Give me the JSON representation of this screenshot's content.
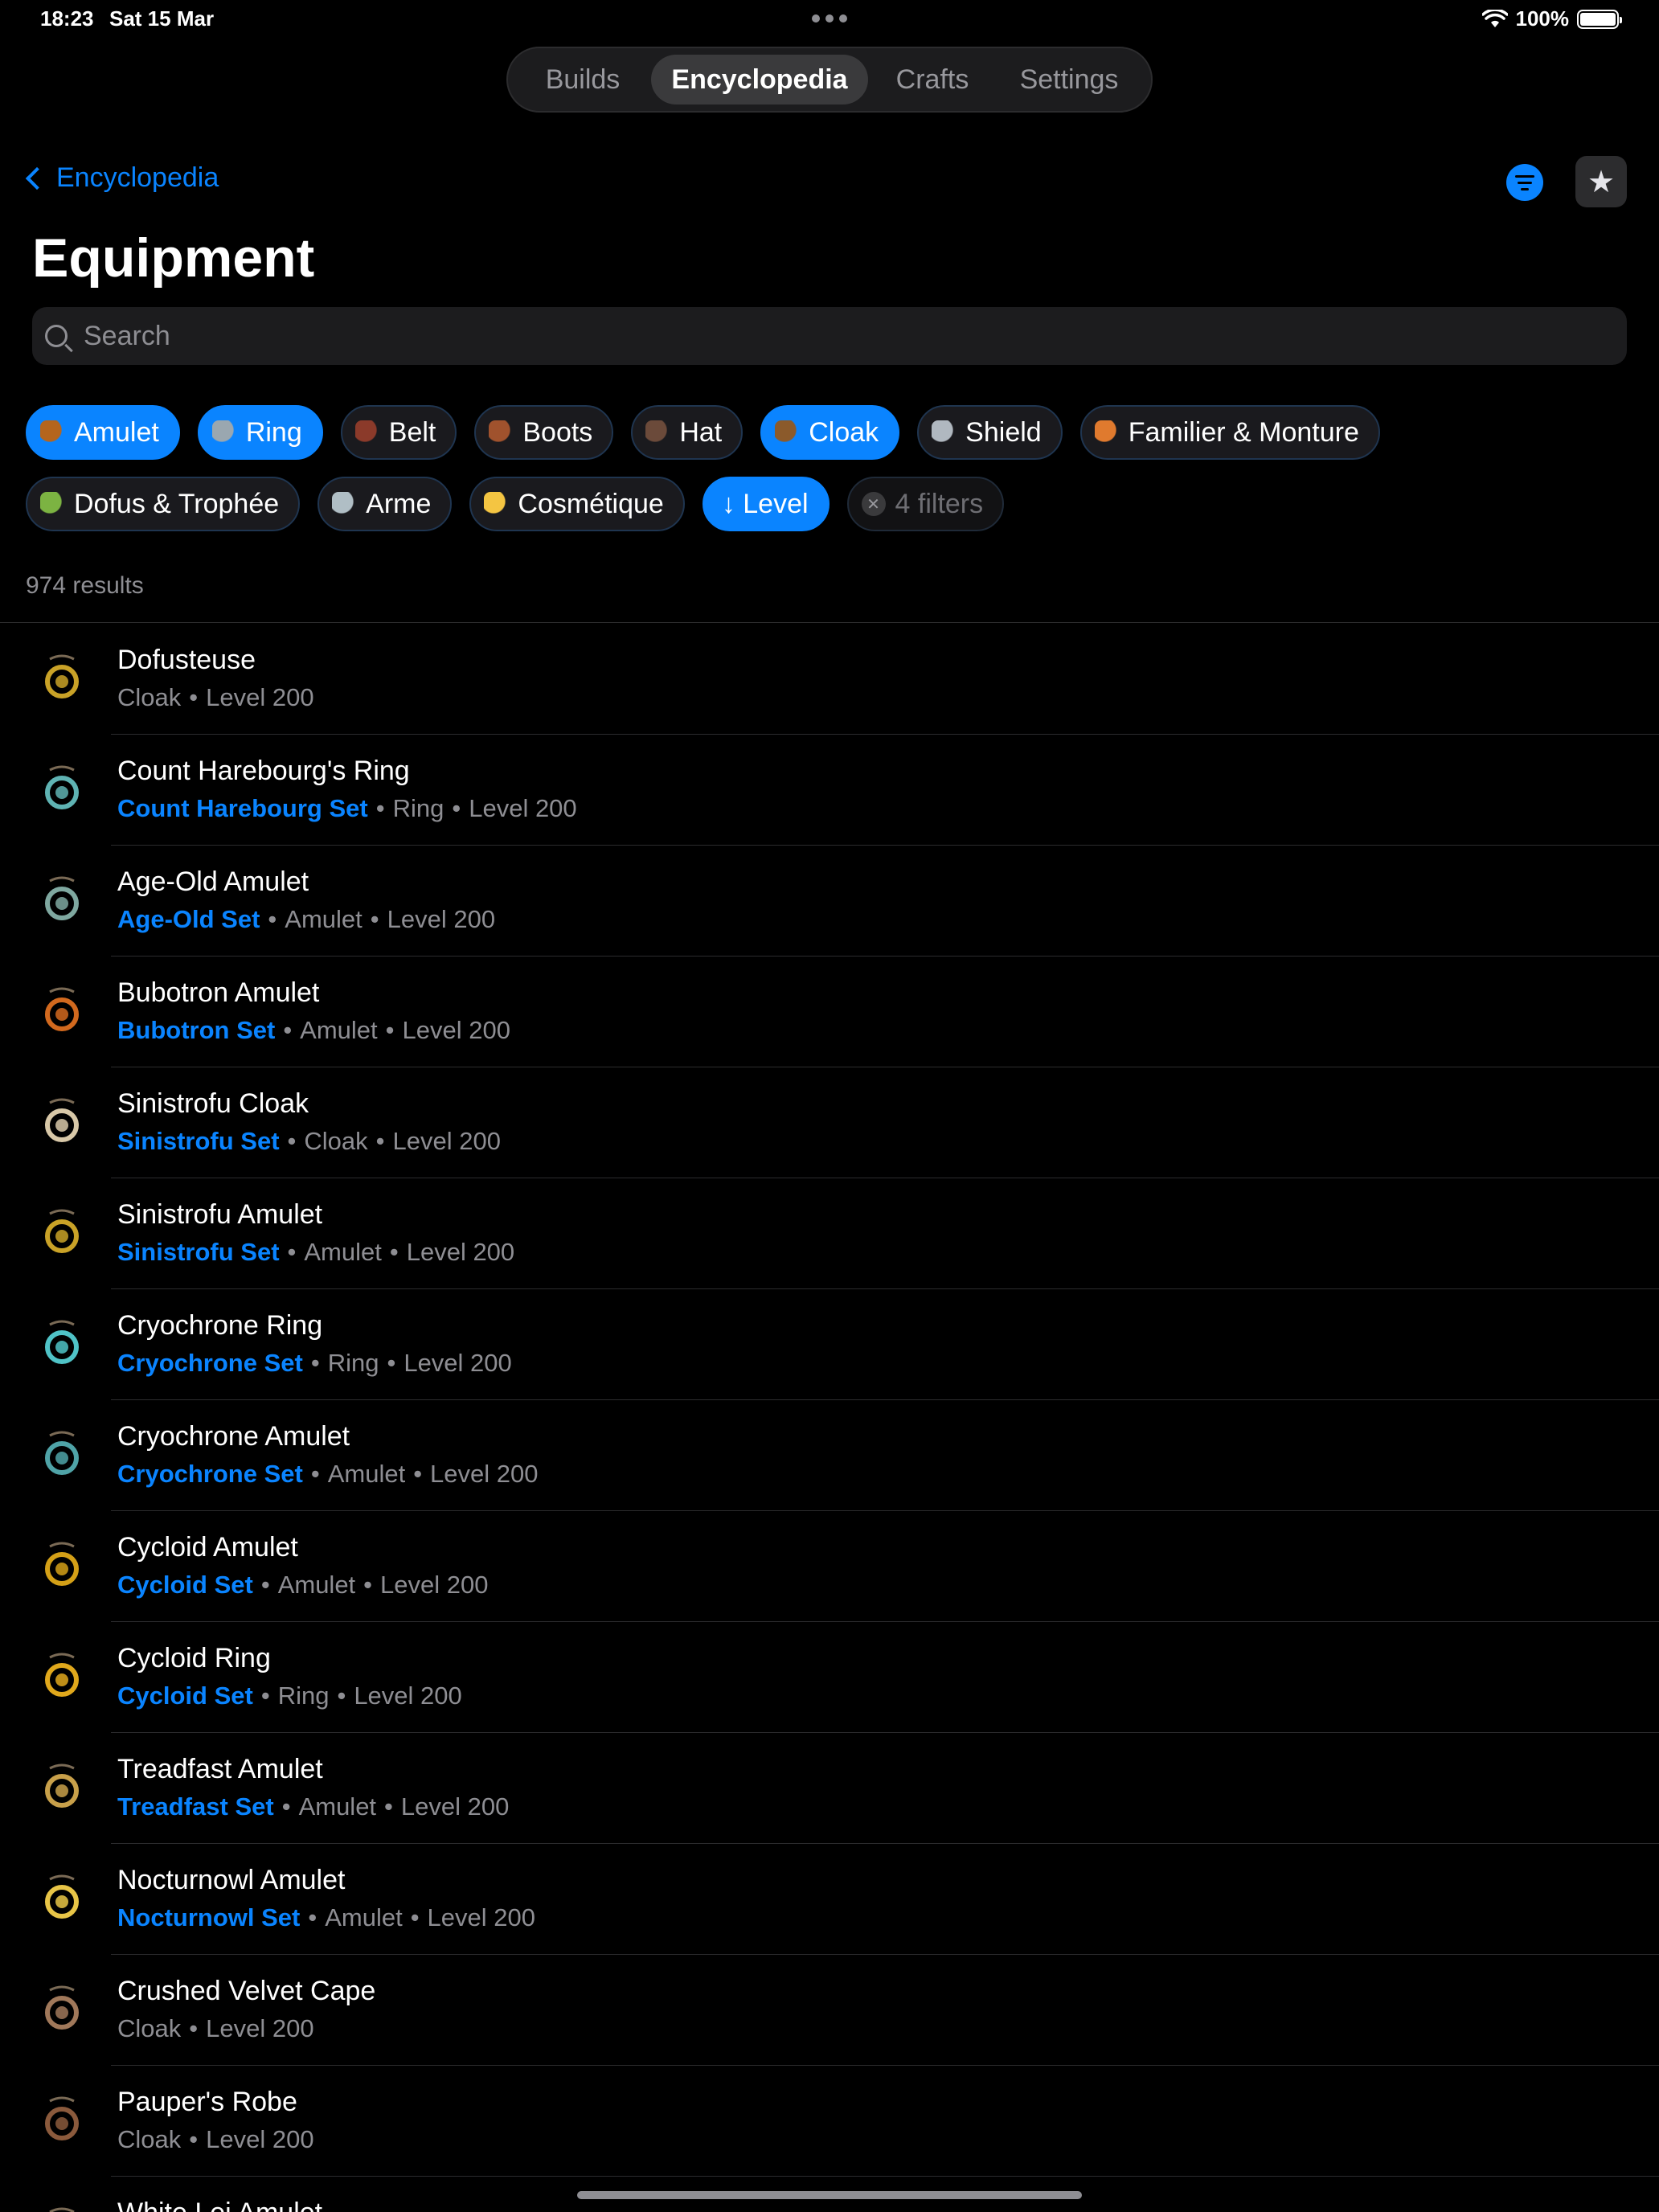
{
  "status": {
    "time": "18:23",
    "date": "Sat 15 Mar",
    "battery": "100%"
  },
  "tabs": [
    {
      "label": "Builds",
      "active": false
    },
    {
      "label": "Encyclopedia",
      "active": true
    },
    {
      "label": "Crafts",
      "active": false
    },
    {
      "label": "Settings",
      "active": false
    }
  ],
  "nav": {
    "back_label": "Encyclopedia"
  },
  "page": {
    "title": "Equipment"
  },
  "search": {
    "placeholder": "Search",
    "value": ""
  },
  "chips_row1": [
    {
      "label": "Amulet",
      "active": true,
      "icon": "amulet-icon",
      "color": "#b5651d"
    },
    {
      "label": "Ring",
      "active": true,
      "icon": "ring-icon",
      "color": "#9aa7b0"
    },
    {
      "label": "Belt",
      "active": false,
      "icon": "belt-icon",
      "color": "#8b3a2a"
    },
    {
      "label": "Boots",
      "active": false,
      "icon": "boots-icon",
      "color": "#a0522d"
    },
    {
      "label": "Hat",
      "active": false,
      "icon": "hat-icon",
      "color": "#6b4a3a"
    },
    {
      "label": "Cloak",
      "active": true,
      "icon": "cloak-icon",
      "color": "#8b5a2b"
    },
    {
      "label": "Shield",
      "active": false,
      "icon": "shield-icon",
      "color": "#b0b8c0"
    },
    {
      "label": "Familier & Monture",
      "active": false,
      "icon": "pet-icon",
      "color": "#e07a2e"
    }
  ],
  "chips_row2": [
    {
      "label": "Dofus & Trophée",
      "active": false,
      "icon": "dofus-egg-icon",
      "color": "#7cb342"
    },
    {
      "label": "Arme",
      "active": false,
      "icon": "weapon-icon",
      "color": "#b0bec5"
    },
    {
      "label": "Cosmétique",
      "active": false,
      "icon": "cosmetic-icon",
      "color": "#f4c542"
    }
  ],
  "sort_chip": {
    "label": "↓ Level"
  },
  "clear_chip": {
    "label": "4 filters"
  },
  "results": {
    "count_text": "974 results"
  },
  "items": [
    {
      "name": "Dofusteuse",
      "set": "",
      "type": "Cloak",
      "level": "Level 200",
      "color": "#c9a227",
      "icon": "dofusteuse-icon"
    },
    {
      "name": "Count Harebourg's Ring",
      "set": "Count Harebourg Set",
      "type": "Ring",
      "level": "Level 200",
      "color": "#5fb3b3",
      "icon": "ring-icon"
    },
    {
      "name": "Age-Old Amulet",
      "set": "Age-Old Set",
      "type": "Amulet",
      "level": "Level 200",
      "color": "#7fa8a0",
      "icon": "amulet-icon"
    },
    {
      "name": "Bubotron Amulet",
      "set": "Bubotron Set",
      "type": "Amulet",
      "level": "Level 200",
      "color": "#d2691e",
      "icon": "amulet-icon"
    },
    {
      "name": "Sinistrofu Cloak",
      "set": "Sinistrofu Set",
      "type": "Cloak",
      "level": "Level 200",
      "color": "#d8c8a8",
      "icon": "cloak-icon"
    },
    {
      "name": "Sinistrofu Amulet",
      "set": "Sinistrofu Set",
      "type": "Amulet",
      "level": "Level 200",
      "color": "#c9a227",
      "icon": "amulet-icon"
    },
    {
      "name": "Cryochrone Ring",
      "set": "Cryochrone Set",
      "type": "Ring",
      "level": "Level 200",
      "color": "#4fc3c7",
      "icon": "ring-icon"
    },
    {
      "name": "Cryochrone Amulet",
      "set": "Cryochrone Set",
      "type": "Amulet",
      "level": "Level 200",
      "color": "#4fa3a7",
      "icon": "amulet-icon"
    },
    {
      "name": "Cycloid Amulet",
      "set": "Cycloid Set",
      "type": "Amulet",
      "level": "Level 200",
      "color": "#d4a017",
      "icon": "amulet-icon"
    },
    {
      "name": "Cycloid Ring",
      "set": "Cycloid Set",
      "type": "Ring",
      "level": "Level 200",
      "color": "#e0a81c",
      "icon": "ring-icon"
    },
    {
      "name": "Treadfast Amulet",
      "set": "Treadfast Set",
      "type": "Amulet",
      "level": "Level 200",
      "color": "#c8a04a",
      "icon": "amulet-icon"
    },
    {
      "name": "Nocturnowl Amulet",
      "set": "Nocturnowl Set",
      "type": "Amulet",
      "level": "Level 200",
      "color": "#e8c547",
      "icon": "amulet-icon"
    },
    {
      "name": "Crushed Velvet Cape",
      "set": "",
      "type": "Cloak",
      "level": "Level 200",
      "color": "#a0785a",
      "icon": "cape-icon"
    },
    {
      "name": "Pauper's Robe",
      "set": "",
      "type": "Cloak",
      "level": "Level 200",
      "color": "#8b5a3c",
      "icon": "robe-icon"
    },
    {
      "name": "White Lei Amulet",
      "set": "",
      "type": "",
      "level": "",
      "color": "#c9a227",
      "icon": "amulet-icon"
    }
  ]
}
